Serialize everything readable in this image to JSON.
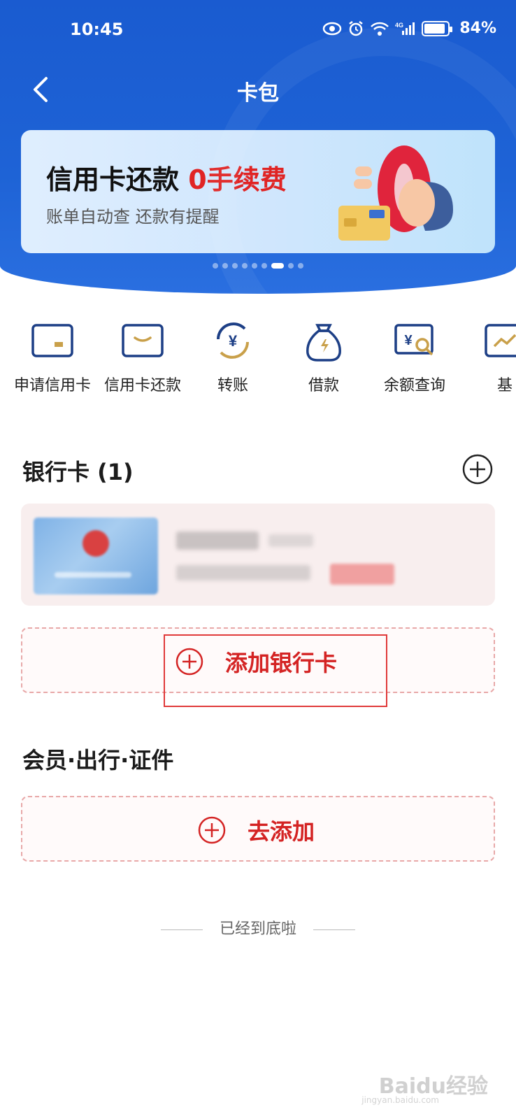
{
  "status_bar": {
    "time": "10:45",
    "network": "4G",
    "battery": "84%"
  },
  "nav": {
    "title": "卡包"
  },
  "banner": {
    "title_main": "信用卡还款",
    "title_highlight": "0手续费",
    "subtitle": "账单自动查 还款有提醒",
    "page_count": 9,
    "active_page": 7
  },
  "quick_actions": [
    {
      "label": "申请信用卡",
      "icon": "credit-card-apply-icon"
    },
    {
      "label": "信用卡还款",
      "icon": "credit-card-repay-icon"
    },
    {
      "label": "转账",
      "icon": "transfer-icon"
    },
    {
      "label": "借款",
      "icon": "loan-bag-icon"
    },
    {
      "label": "余额查询",
      "icon": "balance-query-icon"
    },
    {
      "label": "基",
      "icon": "fund-icon"
    }
  ],
  "bank_section": {
    "title": "银行卡 (1)",
    "add_label": "添加银行卡"
  },
  "member_section": {
    "title": "会员·出行·证件",
    "add_label": "去添加"
  },
  "footer": {
    "end_text": "已经到底啦"
  },
  "watermark": {
    "text": "Baidu经验",
    "sub": "jingyan.baidu.com"
  },
  "colors": {
    "primary_blue": "#1e63d6",
    "accent_red": "#d42323",
    "card_bg": "#f8eeee"
  }
}
